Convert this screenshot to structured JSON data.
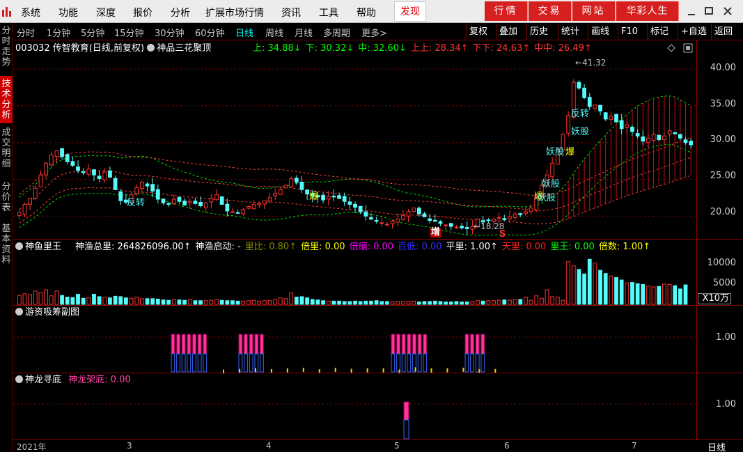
{
  "menu": {
    "items": [
      "系统",
      "功能",
      "深度",
      "报价",
      "分析",
      "扩展市场行情",
      "资讯",
      "工具",
      "帮助"
    ],
    "active_tab": "发现",
    "nav_buttons": [
      "行情",
      "交易",
      "网站",
      "华彩人生"
    ]
  },
  "left_tabs": [
    {
      "label": "分时走势",
      "active": false
    },
    {
      "label": "技术分析",
      "active": true
    },
    {
      "label": "成交明细",
      "active": false
    },
    {
      "label": "分价表",
      "active": false
    },
    {
      "label": "基本资料",
      "active": false
    }
  ],
  "toolbar": {
    "periods": [
      "分时",
      "1分钟",
      "5分钟",
      "15分钟",
      "30分钟",
      "60分钟",
      "日线",
      "周线",
      "月线",
      "多周期",
      "更多>"
    ],
    "active_period": "日线",
    "buttons": [
      "复权",
      "叠加",
      "历史",
      "统计",
      "画线",
      "F10",
      "标记",
      "+自选",
      "返回"
    ]
  },
  "main_panel": {
    "title": "003032 传智教育(日线,前复权)",
    "indicator": "神品三花聚顶",
    "values": [
      {
        "text": "上: 34.88↓",
        "color": "#00ff00"
      },
      {
        "text": "下: 30.32↓",
        "color": "#00ff00"
      },
      {
        "text": "中: 32.60↓",
        "color": "#00ff00"
      },
      {
        "text": "上上: 28.34↑",
        "color": "#ff3333"
      },
      {
        "text": "下下: 24.63↑",
        "color": "#ff3333"
      },
      {
        "text": "中中: 26.49↑",
        "color": "#ff3333"
      }
    ],
    "y_ticks": [
      "40.00",
      "35.00",
      "30.00",
      "25.00",
      "20.00"
    ],
    "high_label": "41.32",
    "low_label": "18.28",
    "annotations": {
      "fanzhuan": "反转",
      "bao": "爆",
      "yaogu": "妖股",
      "zeng": "增",
      "s": "S"
    }
  },
  "volume_panel": {
    "title": "神鱼里王",
    "values": [
      {
        "text": "神渔总里: 264826096.00↑",
        "color": "#ffffff"
      },
      {
        "text": "神渔启动: -",
        "color": "#ffffff"
      },
      {
        "text": "里比: 0.80↑",
        "color": "#888800"
      },
      {
        "text": "倍里: 0.00",
        "color": "#ffff00"
      },
      {
        "text": "倍缩: 0.00",
        "color": "#ff00ff"
      },
      {
        "text": "百低: 0.00",
        "color": "#3333ff"
      },
      {
        "text": "平里: 1.00↑",
        "color": "#ffffff"
      },
      {
        "text": "天里: 0.00",
        "color": "#ff2222"
      },
      {
        "text": "里王: 0.00",
        "color": "#00ff00"
      },
      {
        "text": "倍数: 1.00↑",
        "color": "#ffff00"
      }
    ],
    "y_ticks": [
      "10000",
      "5000"
    ],
    "unit_label": "X10万"
  },
  "sub_panel1": {
    "title": "游资吸筹副图",
    "y_tick": "1.00"
  },
  "sub_panel2": {
    "title": "神龙寻底",
    "value_text": "神龙架底: 0.00",
    "y_tick": "1.00"
  },
  "x_axis": {
    "labels": [
      "2021年",
      "3",
      "4",
      "5",
      "6",
      "7"
    ],
    "period_label": "日线"
  },
  "colors": {
    "up": "#ff3232",
    "down": "#54fcfc",
    "band_red": "#ff4040",
    "band_green": "#00e000",
    "brand_red": "#d61f1f"
  },
  "chart_data": {
    "type": "candlestick",
    "x_labels": [
      "2021年",
      "3",
      "4",
      "5",
      "6",
      "7"
    ],
    "y_ticks": [
      20,
      25,
      30,
      35,
      40
    ],
    "ylim": [
      17,
      42
    ],
    "high": 41.32,
    "low": 18.28,
    "close_series": [
      20.5,
      21.6,
      22.4,
      23.8,
      25.6,
      27.2,
      28.3,
      28.9,
      28.1,
      27.4,
      26.9,
      26.2,
      25.9,
      26.4,
      25.6,
      25.1,
      26.0,
      25.3,
      23.6,
      22.1,
      21.9,
      22.9,
      23.9,
      24.6,
      24.1,
      23.4,
      22.3,
      21.8,
      21.6,
      22.3,
      22.0,
      21.5,
      22.0,
      21.7,
      21.4,
      21.8,
      22.4,
      22.9,
      21.6,
      20.7,
      20.6,
      20.4,
      20.9,
      21.3,
      21.6,
      21.7,
      22.1,
      22.5,
      23.1,
      23.6,
      24.2,
      25.1,
      24.6,
      23.6,
      23.0,
      22.7,
      22.6,
      22.2,
      22.7,
      22.6,
      22.4,
      22.0,
      21.6,
      21.2,
      20.6,
      20.0,
      19.6,
      19.3,
      19.1,
      18.9,
      19.3,
      19.6,
      20.1,
      20.6,
      21.1,
      20.3,
      19.9,
      19.4,
      19.3,
      19.0,
      18.8,
      18.6,
      18.5,
      18.4,
      18.3,
      18.6,
      19.6,
      19.2,
      19.4,
      19.6,
      19.8,
      19.5,
      19.9,
      20.3,
      20.2,
      20.6,
      21.1,
      22.6,
      24.2,
      25.6,
      27.2,
      29.1,
      31.1,
      33.7,
      38.2,
      37.4,
      36.1,
      34.9,
      35.1,
      34.3,
      33.2,
      33.6,
      32.8,
      31.9,
      32.4,
      31.5,
      30.9,
      30.2,
      30.6,
      31.1,
      30.4,
      30.9,
      31.6,
      31.2,
      30.6,
      30.0,
      29.7
    ],
    "volume_series": [
      2200,
      2600,
      2400,
      3300,
      2900,
      3600,
      2100,
      3300,
      2200,
      1800,
      1700,
      2500,
      1500,
      1600,
      2500,
      1900,
      1700,
      1600,
      2000,
      1900,
      1600,
      1500,
      1800,
      1400,
      1400,
      1400,
      1300,
      1100,
      1000,
      1200,
      1100,
      1000,
      1200,
      900,
      900,
      900,
      1000,
      1100,
      1000,
      900,
      900,
      800,
      800,
      900,
      1000,
      800,
      900,
      900,
      1200,
      1600,
      1400,
      2800,
      1800,
      1900,
      1600,
      1200,
      1100,
      900,
      800,
      800,
      800,
      700,
      700,
      800,
      700,
      800,
      800,
      900,
      700,
      700,
      600,
      700,
      700,
      700,
      800,
      600,
      700,
      700,
      800,
      700,
      600,
      600,
      700,
      600,
      600,
      700,
      900,
      800,
      900,
      900,
      1000,
      1100,
      1000,
      1200,
      1200,
      1800,
      1000,
      2100,
      1500,
      3600,
      1900,
      1800,
      1000,
      10500,
      9500,
      8600,
      7500,
      11100,
      10200,
      8400,
      7600,
      7000,
      6600,
      6000,
      5300,
      5400,
      5100,
      4900,
      4500,
      4300,
      4400,
      5000,
      4900,
      4600,
      3800,
      4800
    ],
    "sub1_bar_groups": [
      [
        246,
        298
      ],
      [
        343,
        378
      ],
      [
        562,
        614
      ],
      [
        668,
        692
      ]
    ],
    "sub2_bar": [
      580,
      587
    ]
  }
}
